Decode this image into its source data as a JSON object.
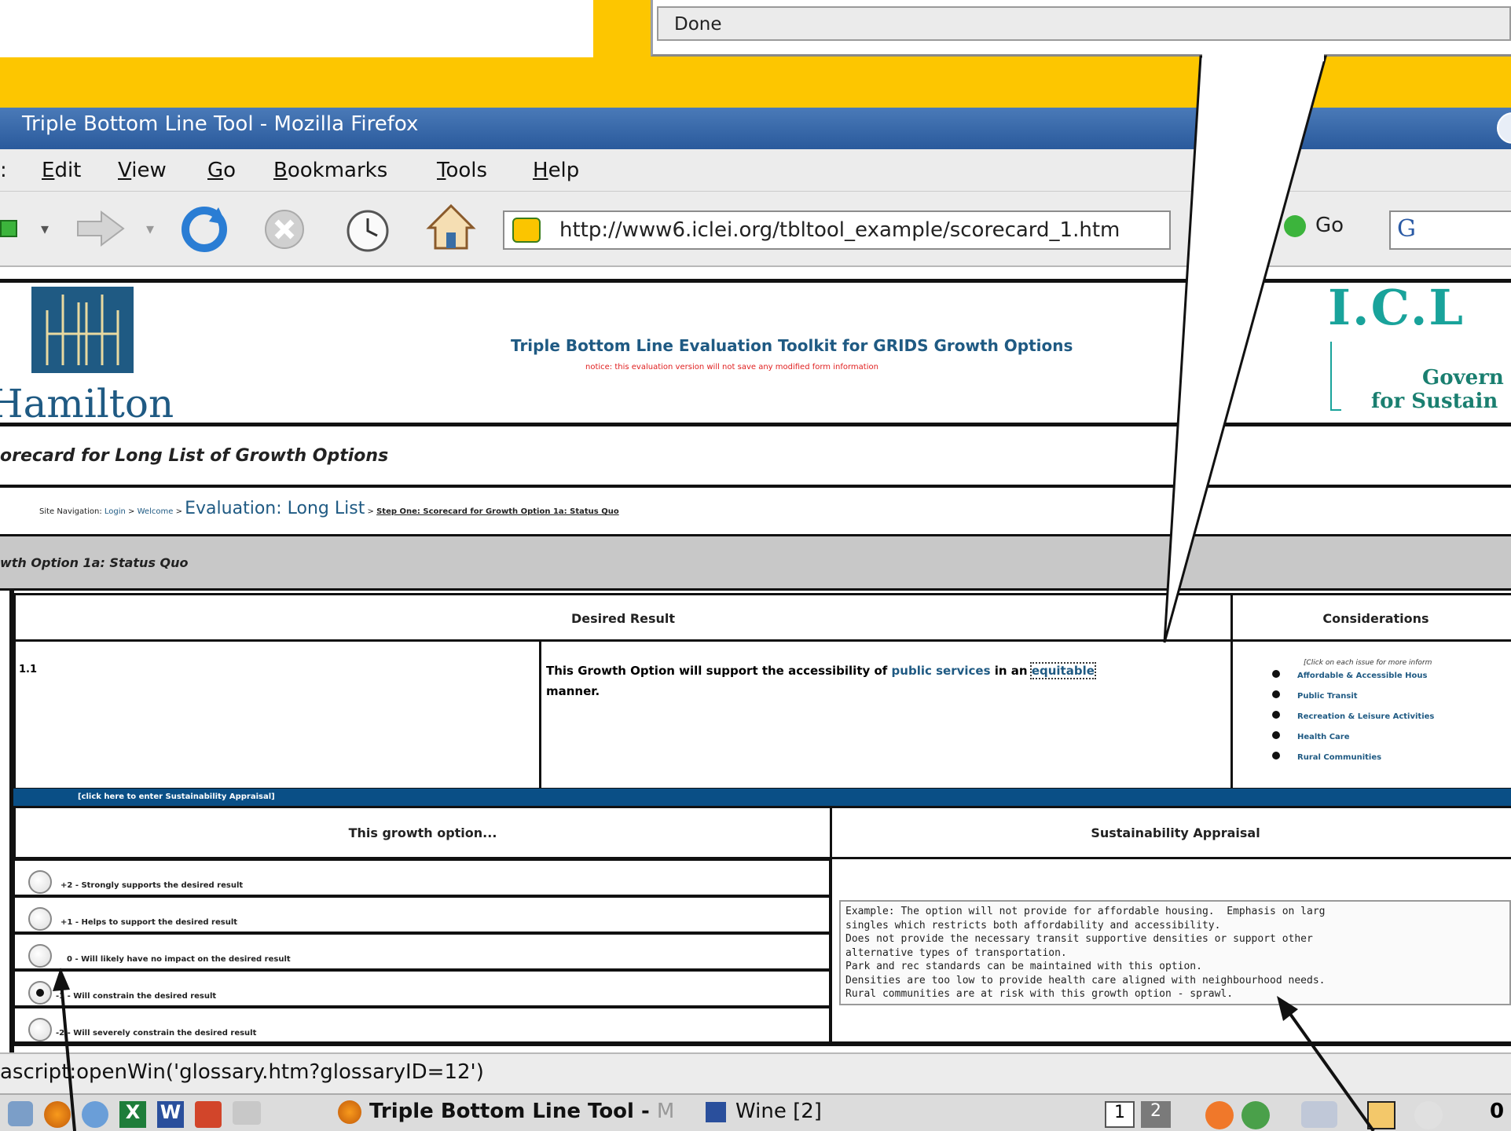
{
  "status_popup": {
    "text": "Done"
  },
  "window": {
    "title": "Triple Bottom Line Tool - Mozilla Firefox"
  },
  "menu": {
    "items": [
      {
        "label": "Edit",
        "accel": "E",
        "rest": "dit"
      },
      {
        "label": "View",
        "accel": "V",
        "rest": "iew"
      },
      {
        "label": "Go",
        "accel": "G",
        "rest": "o"
      },
      {
        "label": "Bookmarks",
        "accel": "B",
        "rest": "ookmarks"
      },
      {
        "label": "Tools",
        "accel": "T",
        "rest": "ools"
      },
      {
        "label": "Help",
        "accel": "H",
        "rest": "elp"
      }
    ]
  },
  "navigation": {
    "url": "http://www6.iclei.org/tbltool_example/scorecard_1.htm",
    "go_label": "Go"
  },
  "header": {
    "logo_text": "Hamilton",
    "toolkit_title": "Triple Bottom Line Evaluation Toolkit for GRIDS Growth Options",
    "notice": "notice: this evaluation version will not save any modified form information",
    "iclei_logo": "I.C.L",
    "iclei_tagline1": "Govern",
    "iclei_tagline2": "for Sustain"
  },
  "page": {
    "scorecard_title": "orecard for Long List of Growth Options",
    "breadcrumb": {
      "prefix": "Site Navigation:",
      "login": "Login",
      "sep": ">",
      "welcome": "Welcome",
      "long_list": "Evaluation: Long List",
      "current": "Step One: Scorecard for Growth Option 1a: Status Quo"
    },
    "option_title": "wth Option 1a: Status Quo"
  },
  "table": {
    "desired_result_header": "Desired Result",
    "considerations_header": "Considerations",
    "row_id": "1.1",
    "desired_text_before": "This Growth Option will support the accessibility of ",
    "public_services_link": "public services",
    "desired_text_mid": " in an ",
    "equitable_link": "equitable",
    "desired_text_after": "manner.",
    "considerations_note": "[Click on each issue for more inform",
    "considerations": [
      "Affordable & Accessible Hous",
      "Public Transit",
      "Recreation & Leisure Activities",
      "Health Care",
      "Rural Communities"
    ],
    "appraisal_link": "[click here to enter Sustainability Appraisal]",
    "growth_option_header": "This growth option...",
    "sustainability_header": "Sustainability Appraisal",
    "options": [
      {
        "label": "+2 - Strongly supports the desired result",
        "checked": false
      },
      {
        "label": "+1 - Helps to support the desired result",
        "checked": false
      },
      {
        "label": "0 - Will likely have no impact on the desired result",
        "checked": false
      },
      {
        "label": "-1 - Will constrain the desired result",
        "checked": true
      },
      {
        "label": "-2 - Will severely constrain the desired result",
        "checked": false
      }
    ],
    "appraisal_text": "Example: The option will not provide for affordable housing.  Emphasis on larg\nsingles which restricts both affordability and accessibility.\nDoes not provide the necessary transit supportive densities or support other\nalternative types of transportation.\nPark and rec standards can be maintained with this option.\nDensities are too low to provide health care aligned with neighbourhood needs.\nRural communities are at risk with this growth option - sprawl."
  },
  "statusbar": {
    "text": "ascript:openWin('glossary.htm?glossaryID=12')"
  },
  "taskbar": {
    "task1": "Triple Bottom Line Tool -",
    "task1_hint": "M",
    "task2": "Wine [2]",
    "desk1": "1",
    "desk2": "2",
    "clock": "0"
  },
  "colors": {
    "accent_yellow": "#fdc600",
    "title_blue": "#2a5a9c",
    "link_blue": "#1f5a83",
    "bar_blue": "#0a4f86",
    "notice_red": "#e02020",
    "iclei_teal": "#19a39b"
  }
}
